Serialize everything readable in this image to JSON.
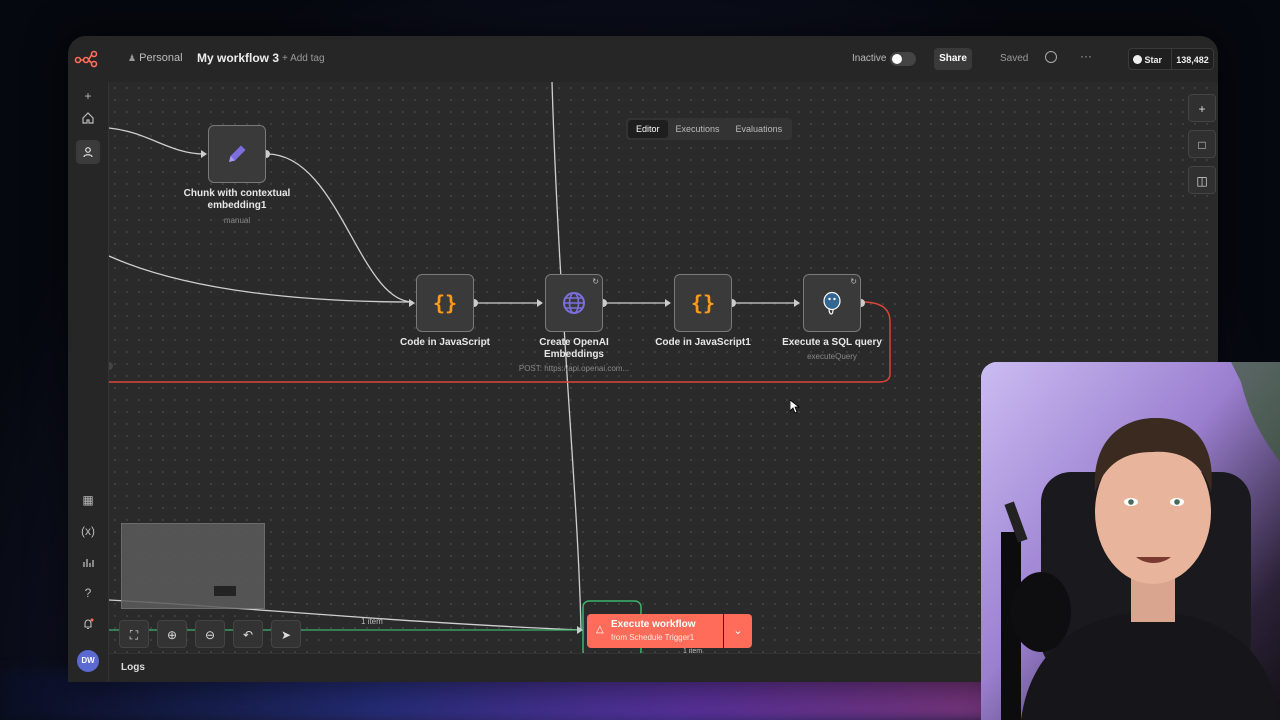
{
  "header": {
    "workspace": "Personal",
    "workflow_title": "My workflow 3",
    "add_tag": "+ Add tag",
    "status_label": "Inactive",
    "share_label": "Share",
    "saved_label": "Saved",
    "github_star": "Star",
    "github_count": "138,482"
  },
  "tabs": [
    {
      "label": "Editor"
    },
    {
      "label": "Executions"
    },
    {
      "label": "Evaluations"
    }
  ],
  "nodes": {
    "chunk": {
      "label": "Chunk with contextual embedding1",
      "sub": "manual"
    },
    "code1": {
      "label": "Code in JavaScript"
    },
    "openai": {
      "label": "Create OpenAI Embeddings",
      "sub": "POST: https://api.openai.com..."
    },
    "code2": {
      "label": "Code in JavaScript1"
    },
    "sql": {
      "label": "Execute a SQL query",
      "sub": "executeQuery"
    }
  },
  "edge_labels": {
    "items1": "1 item",
    "items2": "1 item"
  },
  "execute": {
    "title": "Execute workflow",
    "subtitle": "from Schedule Trigger1"
  },
  "logs": {
    "label": "Logs"
  },
  "avatar_initials": "DW",
  "colors": {
    "accent": "#ff6d5a",
    "canvas": "#2a2a2a",
    "code_icon": "#ff9a1a",
    "http_icon": "#7b6fe0",
    "edge_error": "#e0463a",
    "edge_success": "#3bb36a"
  }
}
